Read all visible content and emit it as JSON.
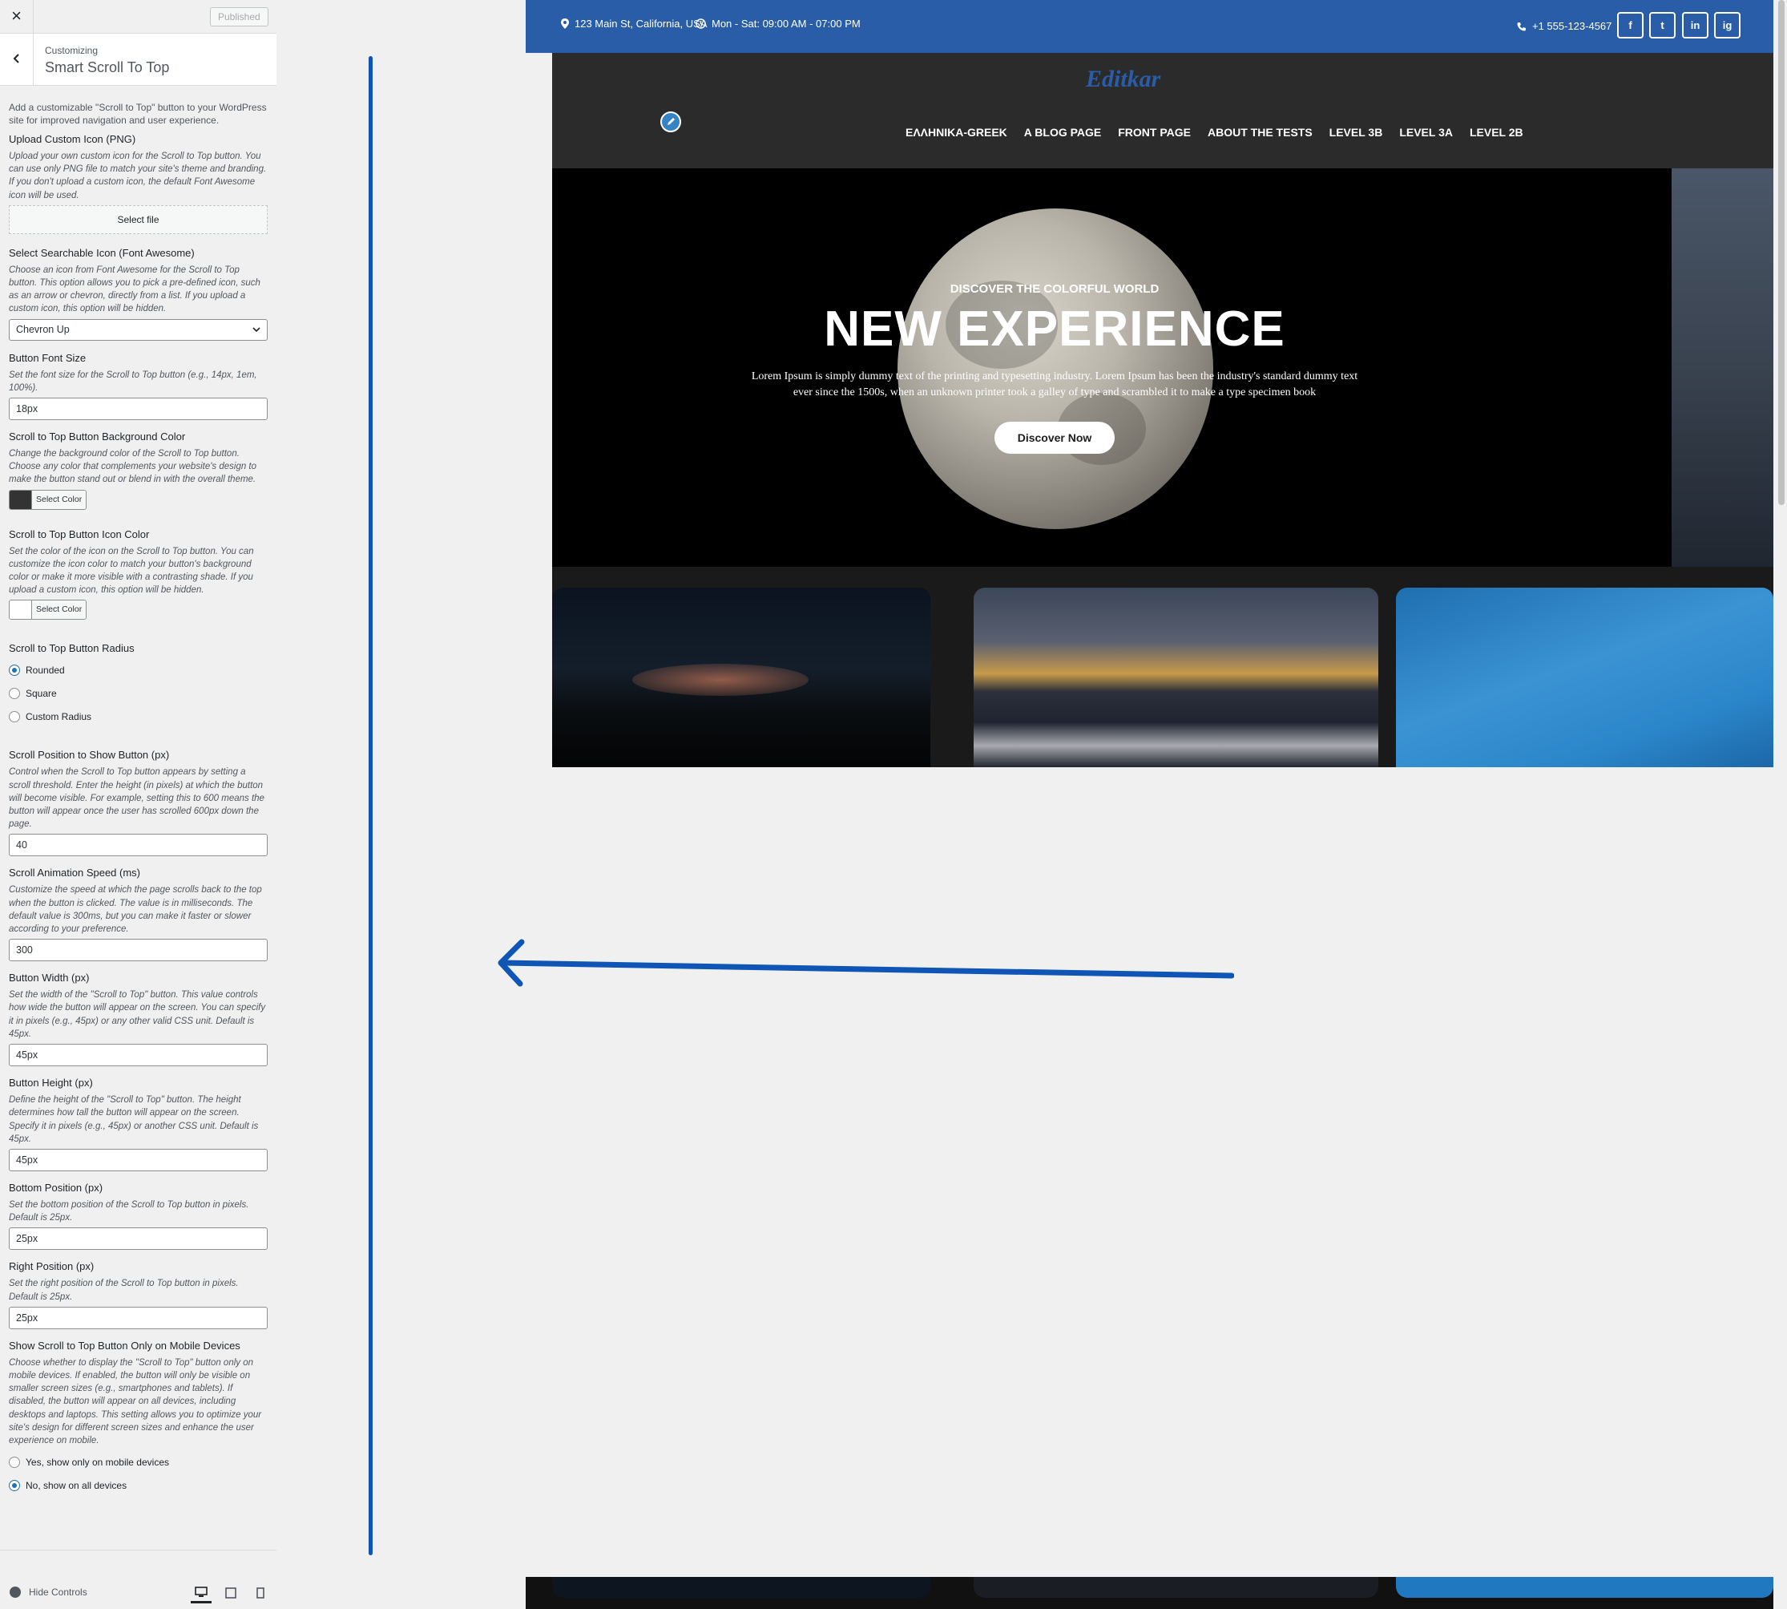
{
  "customizer": {
    "close_label": "×",
    "publish_label": "Published",
    "breadcrumb": "Customizing",
    "panel_title": "Smart Scroll To Top",
    "intro": "Add a customizable \"Scroll to Top\" button to your WordPress site for improved navigation and user experience.",
    "upload_icon": {
      "title": "Upload Custom Icon (PNG)",
      "desc": "Upload your own custom icon for the Scroll to Top button. You can use only PNG file to match your site's theme and branding. If you don't upload a custom icon, the default Font Awesome icon will be used.",
      "button": "Select file"
    },
    "searchable_icon": {
      "title": "Select Searchable Icon (Font Awesome)",
      "desc": "Choose an icon from Font Awesome for the Scroll to Top button. This option allows you to pick a pre-defined icon, such as an arrow or chevron, directly from a list. If you upload a custom icon, this option will be hidden.",
      "selected": "Chevron Up"
    },
    "font_size": {
      "title": "Button Font Size",
      "desc": "Set the font size for the Scroll to Top button (e.g., 14px, 1em, 100%).",
      "value": "18px"
    },
    "bg_color": {
      "title": "Scroll to Top Button Background Color",
      "desc": "Change the background color of the Scroll to Top button. Choose any color that complements your website's design to make the button stand out or blend in with the overall theme.",
      "button": "Select Color",
      "swatch": "#333333"
    },
    "icon_color": {
      "title": "Scroll to Top Button Icon Color",
      "desc": "Set the color of the icon on the Scroll to Top button. You can customize the icon color to match your button's background color or make it more visible with a contrasting shade. If you upload a custom icon, this option will be hidden.",
      "button": "Select Color",
      "swatch": "#ffffff"
    },
    "radius": {
      "title": "Scroll to Top Button Radius",
      "options": [
        "Rounded",
        "Square",
        "Custom Radius"
      ],
      "selected": "Rounded"
    },
    "scroll_position": {
      "title": "Scroll Position to Show Button (px)",
      "desc": "Control when the Scroll to Top button appears by setting a scroll threshold. Enter the height (in pixels) at which the button will become visible. For example, setting this to 600 means the button will appear once the user has scrolled 600px down the page.",
      "value": "40"
    },
    "animation_speed": {
      "title": "Scroll Animation Speed (ms)",
      "desc": "Customize the speed at which the page scrolls back to the top when the button is clicked. The value is in milliseconds. The default value is 300ms, but you can make it faster or slower according to your preference.",
      "value": "300"
    },
    "button_width": {
      "title": "Button Width (px)",
      "desc": "Set the width of the \"Scroll to Top\" button. This value controls how wide the button will appear on the screen. You can specify it in pixels (e.g., 45px) or any other valid CSS unit. Default is 45px.",
      "value": "45px"
    },
    "button_height": {
      "title": "Button Height (px)",
      "desc": "Define the height of the \"Scroll to Top\" button. The height determines how tall the button will appear on the screen. Specify it in pixels (e.g., 45px) or another CSS unit. Default is 45px.",
      "value": "45px"
    },
    "bottom_position": {
      "title": "Bottom Position (px)",
      "desc": "Set the bottom position of the Scroll to Top button in pixels. Default is 25px.",
      "value": "25px"
    },
    "right_position": {
      "title": "Right Position (px)",
      "desc": "Set the right position of the Scroll to Top button in pixels. Default is 25px.",
      "value": "25px"
    },
    "mobile_only": {
      "title": "Show Scroll to Top Button Only on Mobile Devices",
      "desc": "Choose whether to display the \"Scroll to Top\" button only on mobile devices. If enabled, the button will only be visible on smaller screen sizes (e.g., smartphones and tablets). If disabled, the button will appear on all devices, including desktops and laptops. This setting allows you to optimize your site's design for different screen sizes and enhance the user experience on mobile.",
      "options": [
        "Yes, show only on mobile devices",
        "No, show on all devices"
      ],
      "selected": "No, show on all devices"
    },
    "footer": {
      "hide_controls": "Hide Controls"
    }
  },
  "site": {
    "topbar": {
      "address": "123 Main St, California, USA",
      "hours": "Mon - Sat: 09:00 AM - 07:00 PM",
      "phone": "+1 555-123-4567",
      "social": [
        "f",
        "t",
        "in",
        "ig"
      ]
    },
    "logo": "Editkar",
    "nav": [
      "ΕΛΛΗΝΙΚΑ-GREEK",
      "A BLOG PAGE",
      "FRONT PAGE",
      "ABOUT THE TESTS",
      "LEVEL 3B",
      "LEVEL 3A",
      "LEVEL 2B"
    ],
    "hero": {
      "kicker": "DISCOVER THE COLORFUL WORLD",
      "title": "NEW EXPERIENCE",
      "text": "Lorem Ipsum is simply dummy text of the printing and typesetting industry. Lorem Ipsum has been the industry's standard dummy text ever since the 1500s, when an unknown printer took a galley of type and scrambled it to make a type specimen book",
      "button": "Discover Now"
    }
  },
  "colors": {
    "accent": "#2a5da8",
    "annotation": "#0e55b5",
    "wp_blue": "#2271b1"
  }
}
